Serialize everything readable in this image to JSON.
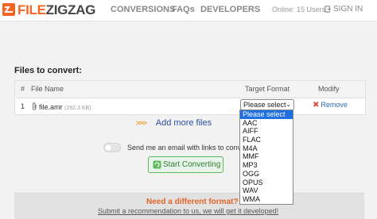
{
  "header": {
    "logo_part1": "FILE",
    "logo_part2": "ZIGZAG",
    "nav": {
      "conversions": "CONVERSIONS",
      "faqs": "FAQs",
      "developers": "DEVELOPERS"
    },
    "online": "Online: 15 Users",
    "sign_in": "SIGN IN"
  },
  "files": {
    "title": "Files to convert:",
    "columns": {
      "num": "#",
      "name": "File Name",
      "target": "Target Format",
      "modify": "Modify"
    },
    "rows": [
      {
        "num": "1",
        "name": "file.amr",
        "size": "(292.3 KB)",
        "target": "Please select",
        "remove": "Remove"
      }
    ]
  },
  "dropdown": {
    "options": [
      "Please select",
      "AAC",
      "AIFF",
      "FLAC",
      "M4A",
      "MMF",
      "MP3",
      "OGG",
      "OPUS",
      "WAV",
      "WMA"
    ],
    "selected": "Please select"
  },
  "add_more": {
    "arrows": ">>>",
    "label": "Add more files"
  },
  "email": {
    "label": "Send me an email with links to conv"
  },
  "start_button": "Start Converting",
  "banner": {
    "title": "Need a different format?",
    "subtitle": "Submit a recommendation to us, we will get it developed!"
  },
  "colors": {
    "brand_orange": "#f26522",
    "accent_green": "#5cb85c",
    "link_blue": "#2b4fa0",
    "select_blue": "#1e6fe0"
  }
}
